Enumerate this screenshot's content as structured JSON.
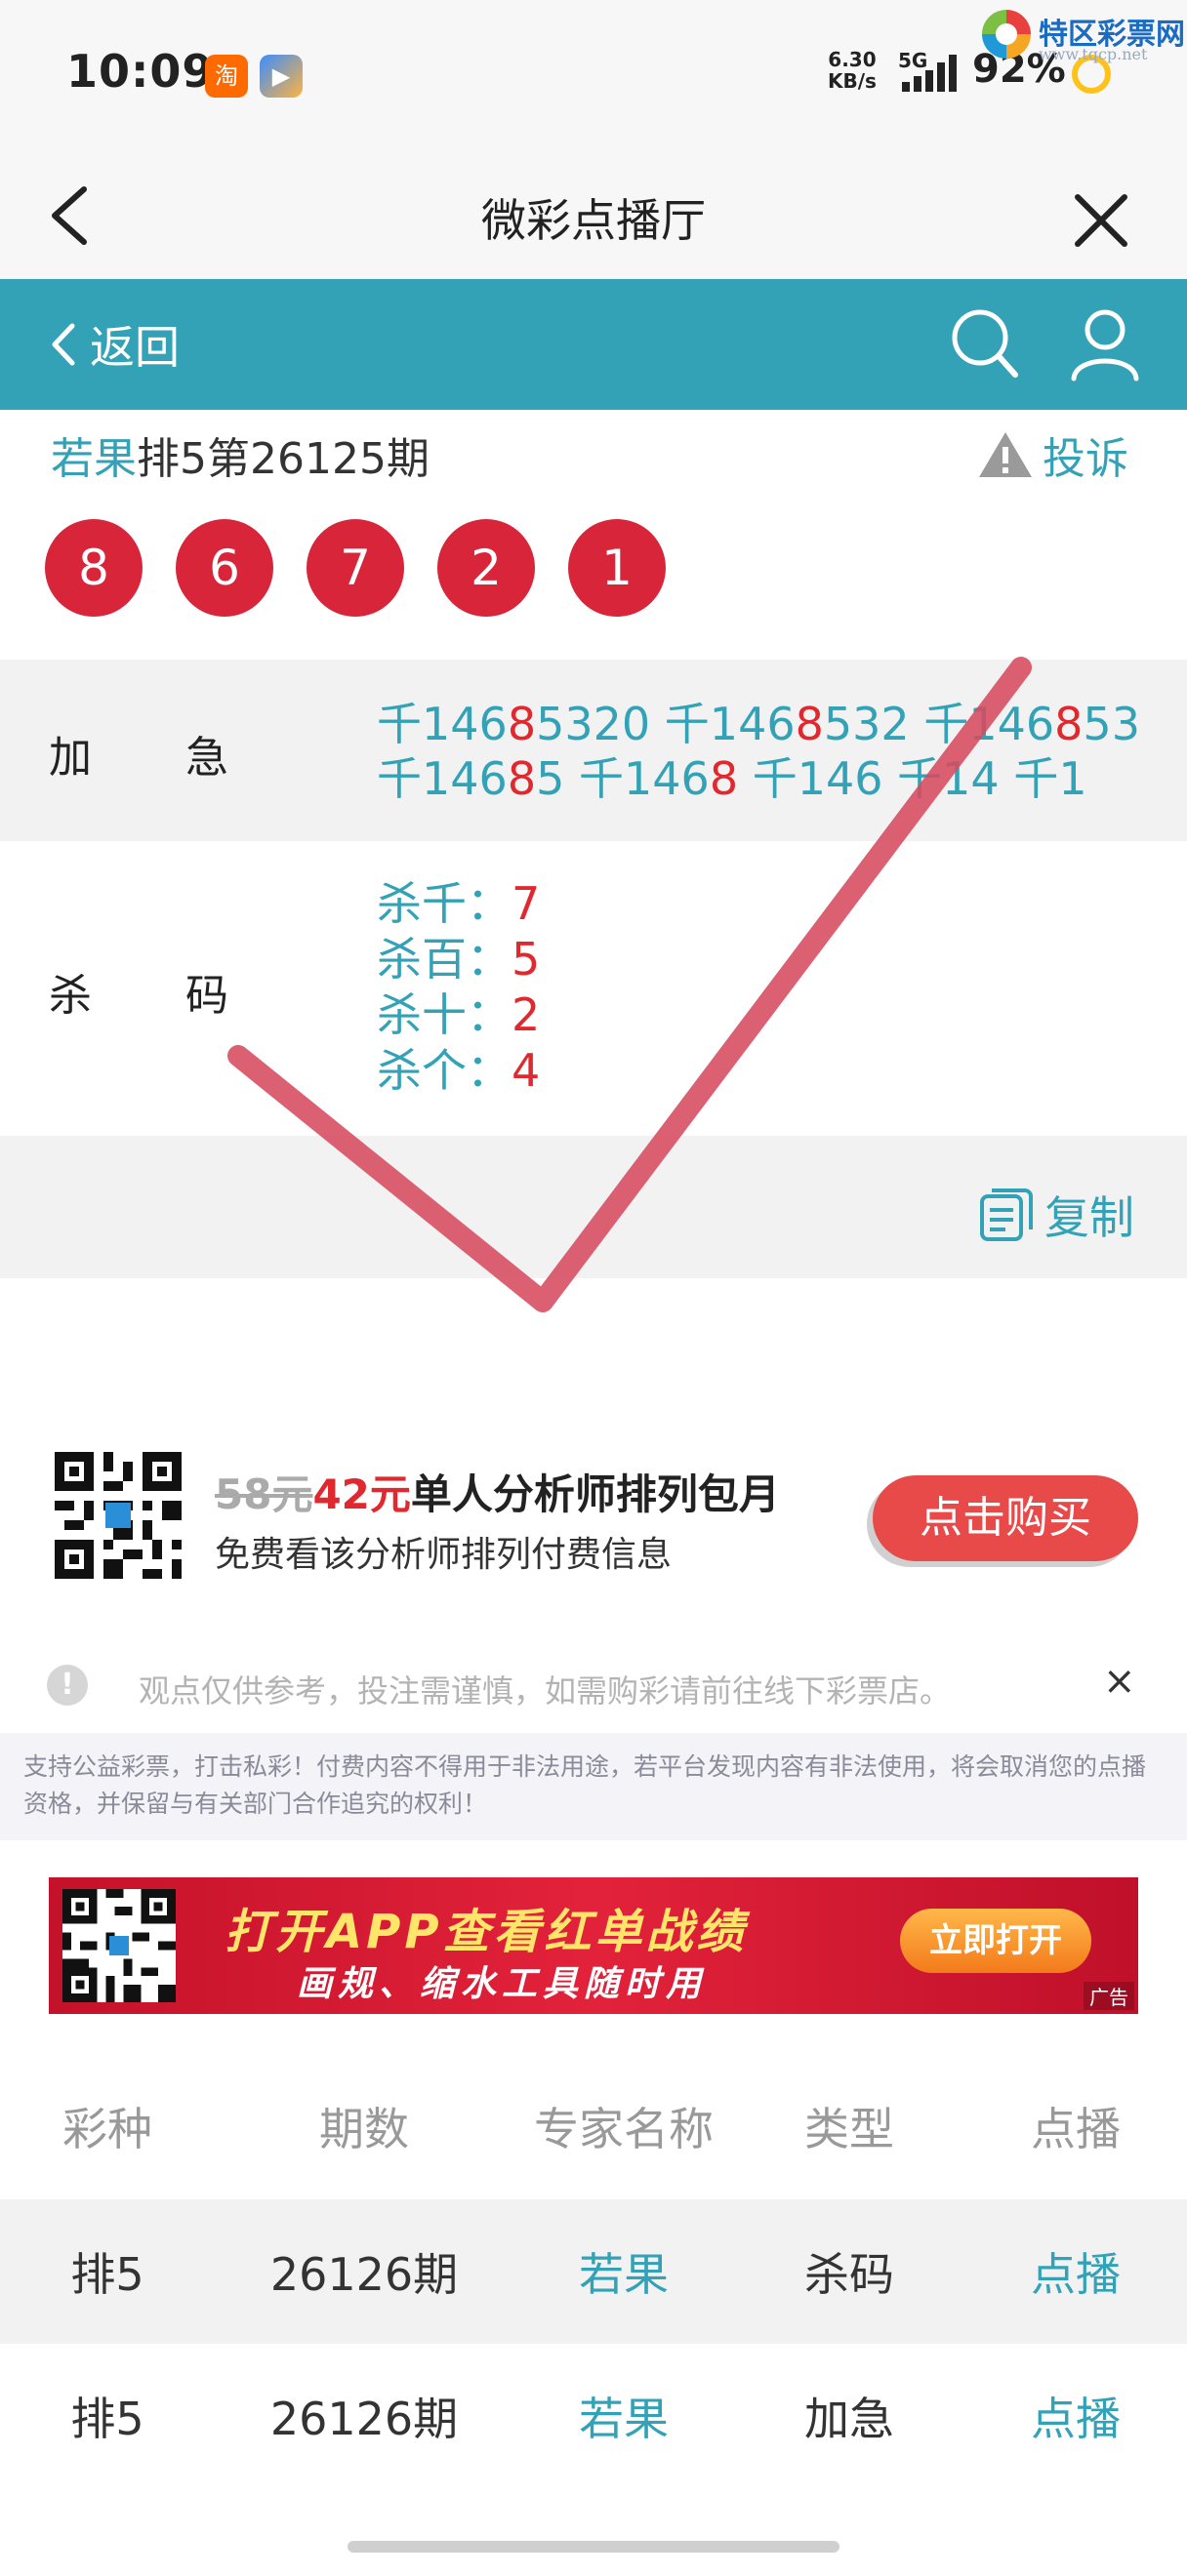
{
  "status_bar": {
    "time": "10:09",
    "app_badges": [
      "淘",
      "▶"
    ],
    "net_speed_value": "6.30",
    "net_speed_unit": "KB/s",
    "network": "5G",
    "battery": "92%"
  },
  "watermark": {
    "name": "特区彩票网",
    "url": "www.tqcp.net"
  },
  "title_bar": {
    "title": "微彩点播厅"
  },
  "nav": {
    "back_label": "返回"
  },
  "issue": {
    "expert": "若果",
    "title": "排5第26125期",
    "complain_label": "投诉"
  },
  "draw_numbers": [
    "8",
    "6",
    "7",
    "2",
    "1"
  ],
  "jiaji": {
    "label": "加急",
    "items": [
      [
        {
          "t": "千146",
          "hl": false
        },
        {
          "t": "8",
          "hl": true
        },
        {
          "t": "5320",
          "hl": false
        }
      ],
      [
        {
          "t": "千146",
          "hl": false
        },
        {
          "t": "8",
          "hl": true
        },
        {
          "t": "532",
          "hl": false
        }
      ],
      [
        {
          "t": "千146",
          "hl": false
        },
        {
          "t": "8",
          "hl": true
        },
        {
          "t": "53",
          "hl": false
        }
      ],
      [
        {
          "t": "千146",
          "hl": false
        },
        {
          "t": "8",
          "hl": true
        },
        {
          "t": "5",
          "hl": false
        }
      ],
      [
        {
          "t": "千146",
          "hl": false
        },
        {
          "t": "8",
          "hl": true
        }
      ],
      [
        {
          "t": "千146",
          "hl": false
        }
      ],
      [
        {
          "t": "千14",
          "hl": false
        }
      ],
      [
        {
          "t": "千1",
          "hl": false
        }
      ]
    ]
  },
  "shama": {
    "label": "杀码",
    "items": [
      {
        "pos": "杀千：",
        "num": "7"
      },
      {
        "pos": "杀百：",
        "num": "5"
      },
      {
        "pos": "杀十：",
        "num": "2"
      },
      {
        "pos": "杀个：",
        "num": "4"
      }
    ]
  },
  "copy_label": "复制",
  "promo": {
    "old_price": "58元",
    "new_price": "42元",
    "title": "单人分析师排列包月",
    "subtitle": "免费看该分析师排列付费信息",
    "buy_label": "点击购买"
  },
  "notice": {
    "text": "观点仅供参考，投注需谨慎，如需购彩请前往线下彩票店。",
    "close": "×"
  },
  "legal_text": "支持公益彩票，打击私彩！付费内容不得用于非法用途，若平台发现内容有非法使用，将会取消您的点播资格，并保留与有关部门合作追究的权利！",
  "ad": {
    "line1": "打开APP查看红单战绩",
    "line2": "画规、缩水工具随时用",
    "button": "立即打开",
    "tag": "广告"
  },
  "table": {
    "headers": [
      "彩种",
      "期数",
      "专家名称",
      "类型",
      "点播"
    ],
    "rows": [
      [
        "排5",
        "26126期",
        "若果",
        "杀码",
        "点播"
      ],
      [
        "排5",
        "26126期",
        "若果",
        "加急",
        "点播"
      ]
    ]
  },
  "colors": {
    "teal": "#34a2b6",
    "red": "#e0292f",
    "ball": "#d8253a"
  }
}
